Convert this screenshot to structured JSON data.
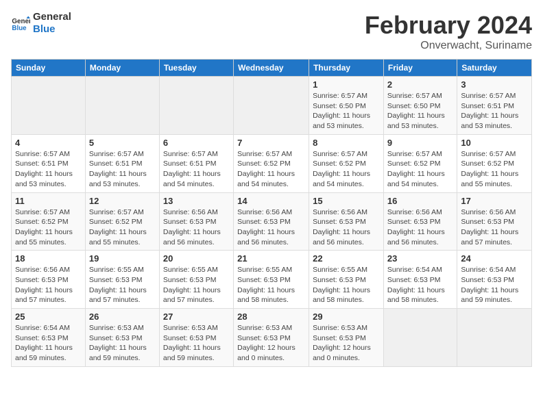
{
  "logo": {
    "line1": "General",
    "line2": "Blue"
  },
  "title": "February 2024",
  "subtitle": "Onverwacht, Suriname",
  "weekdays": [
    "Sunday",
    "Monday",
    "Tuesday",
    "Wednesday",
    "Thursday",
    "Friday",
    "Saturday"
  ],
  "weeks": [
    [
      {
        "day": "",
        "detail": ""
      },
      {
        "day": "",
        "detail": ""
      },
      {
        "day": "",
        "detail": ""
      },
      {
        "day": "",
        "detail": ""
      },
      {
        "day": "1",
        "detail": "Sunrise: 6:57 AM\nSunset: 6:50 PM\nDaylight: 11 hours\nand 53 minutes."
      },
      {
        "day": "2",
        "detail": "Sunrise: 6:57 AM\nSunset: 6:50 PM\nDaylight: 11 hours\nand 53 minutes."
      },
      {
        "day": "3",
        "detail": "Sunrise: 6:57 AM\nSunset: 6:51 PM\nDaylight: 11 hours\nand 53 minutes."
      }
    ],
    [
      {
        "day": "4",
        "detail": "Sunrise: 6:57 AM\nSunset: 6:51 PM\nDaylight: 11 hours\nand 53 minutes."
      },
      {
        "day": "5",
        "detail": "Sunrise: 6:57 AM\nSunset: 6:51 PM\nDaylight: 11 hours\nand 53 minutes."
      },
      {
        "day": "6",
        "detail": "Sunrise: 6:57 AM\nSunset: 6:51 PM\nDaylight: 11 hours\nand 54 minutes."
      },
      {
        "day": "7",
        "detail": "Sunrise: 6:57 AM\nSunset: 6:52 PM\nDaylight: 11 hours\nand 54 minutes."
      },
      {
        "day": "8",
        "detail": "Sunrise: 6:57 AM\nSunset: 6:52 PM\nDaylight: 11 hours\nand 54 minutes."
      },
      {
        "day": "9",
        "detail": "Sunrise: 6:57 AM\nSunset: 6:52 PM\nDaylight: 11 hours\nand 54 minutes."
      },
      {
        "day": "10",
        "detail": "Sunrise: 6:57 AM\nSunset: 6:52 PM\nDaylight: 11 hours\nand 55 minutes."
      }
    ],
    [
      {
        "day": "11",
        "detail": "Sunrise: 6:57 AM\nSunset: 6:52 PM\nDaylight: 11 hours\nand 55 minutes."
      },
      {
        "day": "12",
        "detail": "Sunrise: 6:57 AM\nSunset: 6:52 PM\nDaylight: 11 hours\nand 55 minutes."
      },
      {
        "day": "13",
        "detail": "Sunrise: 6:56 AM\nSunset: 6:53 PM\nDaylight: 11 hours\nand 56 minutes."
      },
      {
        "day": "14",
        "detail": "Sunrise: 6:56 AM\nSunset: 6:53 PM\nDaylight: 11 hours\nand 56 minutes."
      },
      {
        "day": "15",
        "detail": "Sunrise: 6:56 AM\nSunset: 6:53 PM\nDaylight: 11 hours\nand 56 minutes."
      },
      {
        "day": "16",
        "detail": "Sunrise: 6:56 AM\nSunset: 6:53 PM\nDaylight: 11 hours\nand 56 minutes."
      },
      {
        "day": "17",
        "detail": "Sunrise: 6:56 AM\nSunset: 6:53 PM\nDaylight: 11 hours\nand 57 minutes."
      }
    ],
    [
      {
        "day": "18",
        "detail": "Sunrise: 6:56 AM\nSunset: 6:53 PM\nDaylight: 11 hours\nand 57 minutes."
      },
      {
        "day": "19",
        "detail": "Sunrise: 6:55 AM\nSunset: 6:53 PM\nDaylight: 11 hours\nand 57 minutes."
      },
      {
        "day": "20",
        "detail": "Sunrise: 6:55 AM\nSunset: 6:53 PM\nDaylight: 11 hours\nand 57 minutes."
      },
      {
        "day": "21",
        "detail": "Sunrise: 6:55 AM\nSunset: 6:53 PM\nDaylight: 11 hours\nand 58 minutes."
      },
      {
        "day": "22",
        "detail": "Sunrise: 6:55 AM\nSunset: 6:53 PM\nDaylight: 11 hours\nand 58 minutes."
      },
      {
        "day": "23",
        "detail": "Sunrise: 6:54 AM\nSunset: 6:53 PM\nDaylight: 11 hours\nand 58 minutes."
      },
      {
        "day": "24",
        "detail": "Sunrise: 6:54 AM\nSunset: 6:53 PM\nDaylight: 11 hours\nand 59 minutes."
      }
    ],
    [
      {
        "day": "25",
        "detail": "Sunrise: 6:54 AM\nSunset: 6:53 PM\nDaylight: 11 hours\nand 59 minutes."
      },
      {
        "day": "26",
        "detail": "Sunrise: 6:53 AM\nSunset: 6:53 PM\nDaylight: 11 hours\nand 59 minutes."
      },
      {
        "day": "27",
        "detail": "Sunrise: 6:53 AM\nSunset: 6:53 PM\nDaylight: 11 hours\nand 59 minutes."
      },
      {
        "day": "28",
        "detail": "Sunrise: 6:53 AM\nSunset: 6:53 PM\nDaylight: 12 hours\nand 0 minutes."
      },
      {
        "day": "29",
        "detail": "Sunrise: 6:53 AM\nSunset: 6:53 PM\nDaylight: 12 hours\nand 0 minutes."
      },
      {
        "day": "",
        "detail": ""
      },
      {
        "day": "",
        "detail": ""
      }
    ]
  ]
}
